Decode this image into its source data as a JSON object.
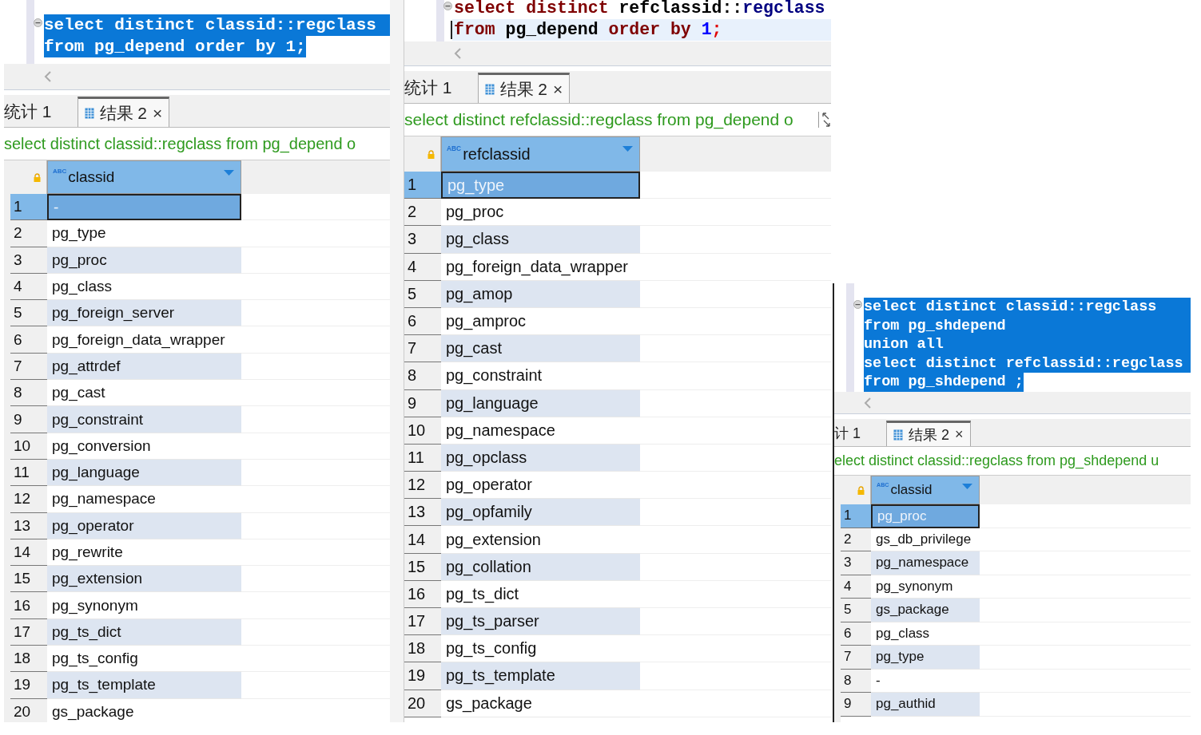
{
  "panels": [
    {
      "editor": {
        "selected": true,
        "lines": [
          {
            "current": false,
            "text": "select distinct classid::regclass"
          },
          {
            "current": false,
            "text": "from pg_depend order by 1;"
          }
        ]
      },
      "tabs": [
        {
          "label": "统计 1",
          "kind": "stats",
          "selected": false
        },
        {
          "label": "结果 2",
          "kind": "result",
          "selected": true,
          "close": "×"
        }
      ],
      "query": "select distinct classid::regclass from pg_depend o",
      "column": {
        "type": "ABC",
        "name": "classid"
      },
      "rows": [
        {
          "num": "1",
          "value": "-",
          "selected": true
        },
        {
          "num": "2",
          "value": "pg_type",
          "selected": false
        },
        {
          "num": "3",
          "value": "pg_proc",
          "selected": false
        },
        {
          "num": "4",
          "value": "pg_class",
          "selected": false
        },
        {
          "num": "5",
          "value": "pg_foreign_server",
          "selected": false
        },
        {
          "num": "6",
          "value": "pg_foreign_data_wrapper",
          "selected": false
        },
        {
          "num": "7",
          "value": "pg_attrdef",
          "selected": false
        },
        {
          "num": "8",
          "value": "pg_cast",
          "selected": false
        },
        {
          "num": "9",
          "value": "pg_constraint",
          "selected": false
        },
        {
          "num": "10",
          "value": "pg_conversion",
          "selected": false
        },
        {
          "num": "11",
          "value": "pg_language",
          "selected": false
        },
        {
          "num": "12",
          "value": "pg_namespace",
          "selected": false
        },
        {
          "num": "13",
          "value": "pg_operator",
          "selected": false
        },
        {
          "num": "14",
          "value": "pg_rewrite",
          "selected": false
        },
        {
          "num": "15",
          "value": "pg_extension",
          "selected": false
        },
        {
          "num": "16",
          "value": "pg_synonym",
          "selected": false
        },
        {
          "num": "17",
          "value": "pg_ts_dict",
          "selected": false
        },
        {
          "num": "18",
          "value": "pg_ts_config",
          "selected": false
        },
        {
          "num": "19",
          "value": "pg_ts_template",
          "selected": false
        },
        {
          "num": "20",
          "value": "gs_package",
          "selected": false
        }
      ]
    },
    {
      "editor": {
        "selected": false,
        "lines": [
          {
            "current": false,
            "tokens": [
              {
                "text": "select distinct ",
                "kind": "keyword"
              },
              {
                "text": "refclassid::",
                "kind": "ident"
              },
              {
                "text": "regclass",
                "kind": "type"
              }
            ]
          },
          {
            "current": true,
            "tokens": [
              {
                "text": "from ",
                "kind": "keyword"
              },
              {
                "text": "pg_depend ",
                "kind": "ident"
              },
              {
                "text": "order by ",
                "kind": "keyword"
              },
              {
                "text": "1",
                "kind": "number"
              },
              {
                "text": ";",
                "kind": "punct"
              }
            ]
          }
        ]
      },
      "tabs": [
        {
          "label": "统计 1",
          "kind": "stats",
          "selected": false
        },
        {
          "label": "结果 2",
          "kind": "result",
          "selected": true,
          "close": "×"
        }
      ],
      "query": "select distinct refclassid::regclass from pg_depend o",
      "column": {
        "type": "ABC",
        "name": "refclassid"
      },
      "rows": [
        {
          "num": "1",
          "value": "pg_type",
          "selected": true
        },
        {
          "num": "2",
          "value": "pg_proc",
          "selected": false
        },
        {
          "num": "3",
          "value": "pg_class",
          "selected": false
        },
        {
          "num": "4",
          "value": "pg_foreign_data_wrapper",
          "selected": false
        },
        {
          "num": "5",
          "value": "pg_amop",
          "selected": false
        },
        {
          "num": "6",
          "value": "pg_amproc",
          "selected": false
        },
        {
          "num": "7",
          "value": "pg_cast",
          "selected": false
        },
        {
          "num": "8",
          "value": "pg_constraint",
          "selected": false
        },
        {
          "num": "9",
          "value": "pg_language",
          "selected": false
        },
        {
          "num": "10",
          "value": "pg_namespace",
          "selected": false
        },
        {
          "num": "11",
          "value": "pg_opclass",
          "selected": false
        },
        {
          "num": "12",
          "value": "pg_operator",
          "selected": false
        },
        {
          "num": "13",
          "value": "pg_opfamily",
          "selected": false
        },
        {
          "num": "14",
          "value": "pg_extension",
          "selected": false
        },
        {
          "num": "15",
          "value": "pg_collation",
          "selected": false
        },
        {
          "num": "16",
          "value": "pg_ts_dict",
          "selected": false
        },
        {
          "num": "17",
          "value": "pg_ts_parser",
          "selected": false
        },
        {
          "num": "18",
          "value": "pg_ts_config",
          "selected": false
        },
        {
          "num": "19",
          "value": "pg_ts_template",
          "selected": false
        },
        {
          "num": "20",
          "value": "gs_package",
          "selected": false
        }
      ]
    },
    {
      "editor": {
        "selected": true,
        "lines": [
          {
            "current": false,
            "text": "select distinct classid::regclass"
          },
          {
            "current": false,
            "text": "from pg_shdepend"
          },
          {
            "current": false,
            "text": "union all"
          },
          {
            "current": false,
            "text": "select distinct refclassid::regclass"
          },
          {
            "current": false,
            "text": "from pg_shdepend ;"
          }
        ]
      },
      "tabs": [
        {
          "label": "计 1",
          "kind": "stats",
          "selected": false
        },
        {
          "label": "结果 2",
          "kind": "result",
          "selected": true,
          "close": "×"
        }
      ],
      "query": "elect distinct classid::regclass from pg_shdepend u",
      "column": {
        "type": "ABC",
        "name": "classid"
      },
      "rows": [
        {
          "num": "1",
          "value": "pg_proc",
          "selected": true
        },
        {
          "num": "2",
          "value": "gs_db_privilege",
          "selected": false
        },
        {
          "num": "3",
          "value": "pg_namespace",
          "selected": false
        },
        {
          "num": "4",
          "value": "pg_synonym",
          "selected": false
        },
        {
          "num": "5",
          "value": "gs_package",
          "selected": false
        },
        {
          "num": "6",
          "value": "pg_class",
          "selected": false
        },
        {
          "num": "7",
          "value": "pg_type",
          "selected": false
        },
        {
          "num": "8",
          "value": "-",
          "selected": false
        },
        {
          "num": "9",
          "value": "pg_authid",
          "selected": false
        }
      ]
    }
  ]
}
